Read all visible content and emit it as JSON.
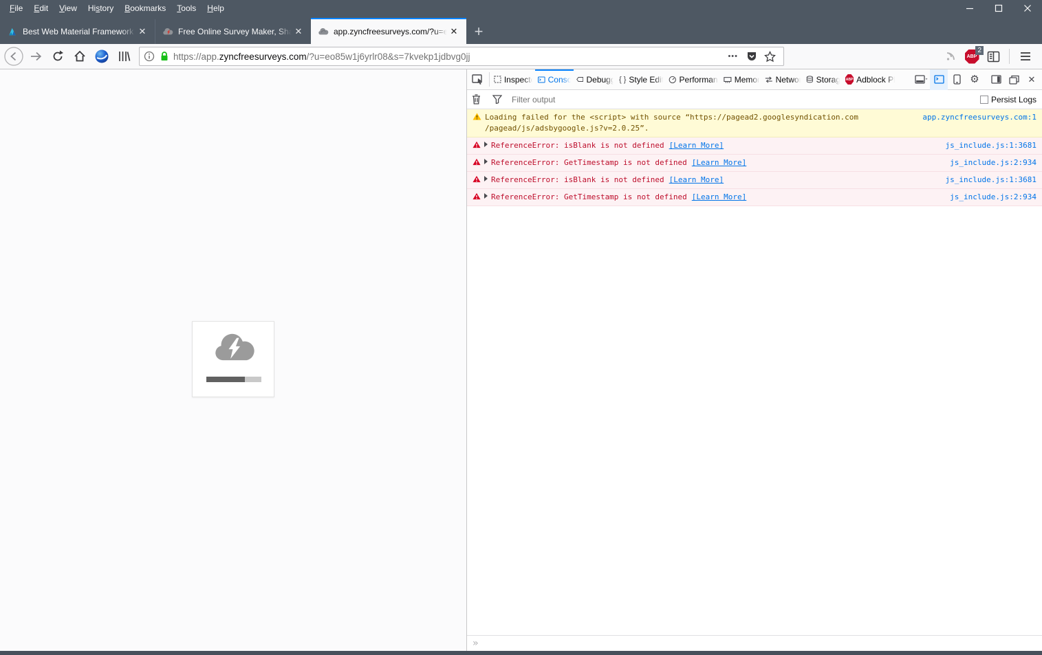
{
  "menu_bar": {
    "items": [
      {
        "pre": "",
        "key": "F",
        "post": "ile"
      },
      {
        "pre": "",
        "key": "E",
        "post": "dit"
      },
      {
        "pre": "",
        "key": "V",
        "post": "iew"
      },
      {
        "pre": "Hi",
        "key": "s",
        "post": "tory"
      },
      {
        "pre": "",
        "key": "B",
        "post": "ookmarks"
      },
      {
        "pre": "",
        "key": "T",
        "post": "ools"
      },
      {
        "pre": "",
        "key": "H",
        "post": "elp"
      }
    ]
  },
  "tab_bar": {
    "tabs": [
      {
        "title": "Best Web Material Framework A",
        "favicon": "flame-logo",
        "close_glyph": "✕"
      },
      {
        "title": "Free Online Survey Maker, Shar",
        "favicon": "cloud-red-bolt",
        "close_glyph": "✕"
      },
      {
        "title": "app.zyncfreesurveys.com/?u=e",
        "favicon": "gray-cloud",
        "close_glyph": "✕"
      }
    ],
    "new_tab_glyph": "+"
  },
  "nav_toolbar": {
    "url": {
      "scheme_subdomain": "https://app.",
      "domain": "zyncfreesurveys.com",
      "path": "/?u=eo85w1j6yrlr08&s=7kvekp1jdbvg0jj"
    },
    "page_actions_glyph": "•••",
    "adblock_label": "ABP",
    "adblock_badge": "2"
  },
  "devtools": {
    "tabs": [
      {
        "label": "Inspector"
      },
      {
        "label": "Console"
      },
      {
        "label": "Debugger"
      },
      {
        "label": "Style Editor"
      },
      {
        "label": "Performance"
      },
      {
        "label": "Memory"
      },
      {
        "label": "Network"
      },
      {
        "label": "Storage"
      },
      {
        "label": "Adblock Plus"
      }
    ],
    "adblock_tab_icon_label": "ABP",
    "style_editor_glyph": "{ }",
    "gear_glyph": "⚙",
    "close_glyph": "✕",
    "filter": {
      "placeholder": "Filter output",
      "persist_label": "Persist Logs",
      "persist_checked": false
    },
    "console": {
      "warning": {
        "lines": [
          "Loading failed for the <script> with source “https://pagead2.googlesyndication.com",
          "/pagead/js/adsbygoogle.js?v=2.0.25”."
        ],
        "source": "app.zyncfreesurveys.com:1"
      },
      "errors": [
        {
          "message": "ReferenceError: isBlank is not defined",
          "link": "[Learn More]",
          "source": "js_include.js:1:3681"
        },
        {
          "message": "ReferenceError: GetTimestamp is not defined",
          "link": "[Learn More]",
          "source": "js_include.js:2:934"
        },
        {
          "message": "ReferenceError: isBlank is not defined",
          "link": "[Learn More]",
          "source": "js_include.js:1:3681"
        },
        {
          "message": "ReferenceError: GetTimestamp is not defined",
          "link": "[Learn More]",
          "source": "js_include.js:2:934"
        }
      ],
      "prompt_glyph": "»"
    }
  },
  "colors": {
    "chrome_dark": "#4e5863",
    "accent_blue": "#0a84ff",
    "link_blue": "#0074e8",
    "warning_bg": "#fffbd6",
    "warning_text": "#715100",
    "error_bg": "#fdf2f4",
    "error_text": "#bd0d2b",
    "abp_red": "#c70d2c",
    "lock_green": "#17bf17"
  }
}
